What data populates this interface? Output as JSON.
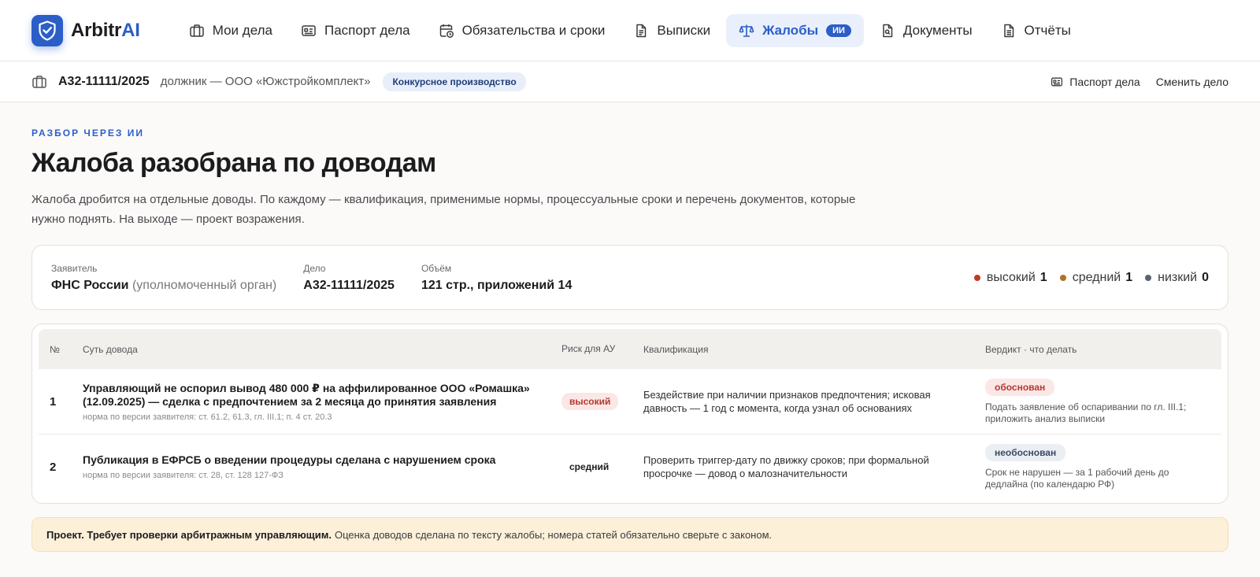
{
  "brand": {
    "name_main": "Arbitr",
    "name_accent": "AI",
    "logo_icon": "shield-check-icon"
  },
  "nav": {
    "items": [
      {
        "label": "Мои дела",
        "icon": "briefcase-icon"
      },
      {
        "label": "Паспорт дела",
        "icon": "id-card-icon"
      },
      {
        "label": "Обязательства и сроки",
        "icon": "calendar-clock-icon"
      },
      {
        "label": "Выписки",
        "icon": "document-list-icon"
      },
      {
        "label": "Жалобы",
        "icon": "scales-icon",
        "badge": "ИИ",
        "active": true
      },
      {
        "label": "Документы",
        "icon": "document-search-icon"
      },
      {
        "label": "Отчёты",
        "icon": "report-icon"
      }
    ]
  },
  "case_bar": {
    "case_number": "А32-11111/2025",
    "debtor": "должник — ООО «Южстройкомплект»",
    "procedure_tag": "Конкурсное производство",
    "passport_link": "Паспорт дела",
    "switch_link": "Сменить дело"
  },
  "page": {
    "eyebrow": "РАЗБОР ЧЕРЕЗ ИИ",
    "title": "Жалоба разобрана по доводам",
    "description": "Жалоба дробится на отдельные доводы. По каждому — квалификация, применимые нормы, процессуальные сроки и перечень документов, которые нужно поднять. На выходе — проект возражения."
  },
  "summary": {
    "applicant_label": "Заявитель",
    "applicant_value": "ФНС России",
    "applicant_note": "(уполномоченный орган)",
    "case_label": "Дело",
    "case_value": "А32-11111/2025",
    "volume_label": "Объём",
    "volume_value": "121 стр., приложений 14",
    "risk_counts": [
      {
        "label": "высокий",
        "count": "1",
        "color": "#c0392b"
      },
      {
        "label": "средний",
        "count": "1",
        "color": "#b0702a"
      },
      {
        "label": "низкий",
        "count": "0",
        "color": "#5b6270"
      }
    ]
  },
  "table": {
    "headers": {
      "num": "№",
      "essence": "Суть довода",
      "risk": "Риск для АУ",
      "qualification": "Квалификация",
      "verdict": "Вердикт · что делать"
    },
    "rows": [
      {
        "num": "1",
        "title": "Управляющий не оспорил вывод 480 000 ₽ на аффилированное ООО «Ромашка» (12.09.2025) — сделка с предпочтением за 2 месяца до принятия заявления",
        "norm": "норма по версии заявителя: ст. 61.2, 61.3, гл. III.1; п. 4 ст. 20.3",
        "risk": "высокий",
        "qualification": "Бездействие при наличии признаков предпочтения; исковая давность — 1 год с момента, когда узнал об основаниях",
        "verdict": "обоснован",
        "verdict_note": "Подать заявление об оспаривании по гл. III.1; приложить анализ выписки"
      },
      {
        "num": "2",
        "title": "Публикация в ЕФРСБ о введении процедуры сделана с нарушением срока",
        "norm": "норма по версии заявителя: ст. 28, ст. 128 127-ФЗ",
        "risk": "средний",
        "qualification": "Проверить триггер-дату по движку сроков; при формальной просрочке — довод о малозначительности",
        "verdict": "необоснован",
        "verdict_note": "Срок не нарушен — за 1 рабочий день до дедлайна (по календарю РФ)"
      }
    ]
  },
  "notice": {
    "bold": "Проект. Требует проверки арбитражным управляющим.",
    "text": "Оценка доводов сделана по тексту жалобы; номера статей обязательно сверьте с законом."
  }
}
